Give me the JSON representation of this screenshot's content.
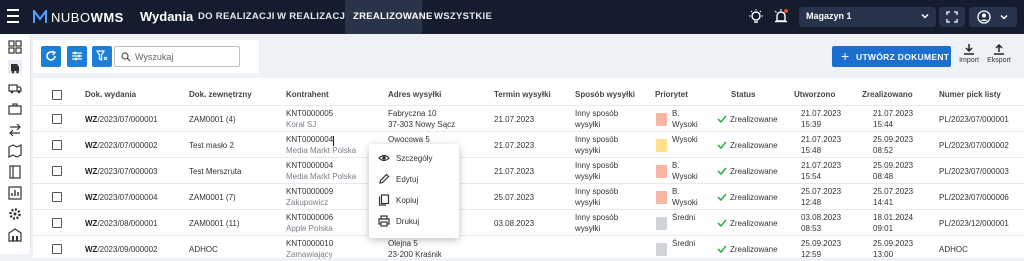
{
  "app": {
    "logo": "NUBOWMS",
    "logo_prefix": "NUBO",
    "logo_suffix": "WMS",
    "page_title": "Wydania"
  },
  "tabs": [
    {
      "label": "DO REALIZACJI"
    },
    {
      "label": "W REALIZACJI"
    },
    {
      "label": "ZREALIZOWANE"
    },
    {
      "label": "WSZYSTKIE"
    }
  ],
  "active_tab": "ZREALIZOWANE",
  "warehouse_select": {
    "value": "Magazyn 1"
  },
  "toolbar": {
    "search_placeholder": "Wyszukaj",
    "create_label": "UTWÓRZ DOKUMENT",
    "create_plus": "+",
    "import_label": "Import",
    "export_label": "Eksport"
  },
  "table": {
    "headers": [
      "Dok. wydania",
      "Dok. zewnętrzny",
      "Kontrahent",
      "Adres wysyłki",
      "Termin wysyłki",
      "Sposób wysyłki",
      "Priorytet",
      "Status",
      "Utworzono",
      "Zrealizowano",
      "Numer pick listy"
    ],
    "rows": [
      {
        "doc_prefix": "WZ",
        "doc_rest": "/2023/07/000001",
        "external": "ZAM0001 (4)",
        "contractor_code": "KNT0000005",
        "contractor_name": "Koral SJ",
        "address_1": "Fabryczna 10",
        "address_2": "37-303 Nowy Sącz",
        "ship_date": "21.07.2023",
        "ship_method_1": "Inny sposób",
        "ship_method_2": "wysyłki",
        "priority_1": "B.",
        "priority_2": "Wysoki",
        "status": "Zrealizowane",
        "created_date": "21.07.2023",
        "created_time": "15:39",
        "done_date": "21.07.2023",
        "done_time": "15:44",
        "pick_list": "PL/2023/07/000001"
      },
      {
        "doc_prefix": "WZ",
        "doc_rest": "/2023/07/000002",
        "external": "Test masło 2",
        "contractor_code": "KNT0000004",
        "contractor_name": "Media Markt Polska",
        "address_1": "Owocowa 5",
        "address_2": "",
        "ship_date": "21.07.2023",
        "ship_method_1": "Inny sposób",
        "ship_method_2": "wysyłki",
        "priority_1": "Wysoki",
        "priority_2": "",
        "status": "Zrealizowane",
        "created_date": "21.07.2023",
        "created_time": "15:48",
        "done_date": "25.09.2023",
        "done_time": "08:52",
        "pick_list": "PL/2023/07/000002"
      },
      {
        "doc_prefix": "WZ",
        "doc_rest": "/2023/07/000003",
        "external": "Test Merszruta",
        "contractor_code": "KNT0000004",
        "contractor_name": "Media Markt Polska",
        "address_1": "",
        "address_2": "",
        "ship_date": "21.07.2023",
        "ship_method_1": "Inny sposób",
        "ship_method_2": "wysyłki",
        "priority_1": "B.",
        "priority_2": "Wysoki",
        "status": "Zrealizowane",
        "created_date": "21.07.2023",
        "created_time": "15:54",
        "done_date": "25.09.2023",
        "done_time": "08:48",
        "pick_list": "PL/2023/07/000003"
      },
      {
        "doc_prefix": "WZ",
        "doc_rest": "/2023/07/000004",
        "external": "ZAM0001 (7)",
        "contractor_code": "KNT0000009",
        "contractor_name": "Zakupowicz",
        "address_1": "",
        "address_2": "",
        "ship_date": "25.07.2023",
        "ship_method_1": "Inny sposób",
        "ship_method_2": "wysyłki",
        "priority_1": "B.",
        "priority_2": "Wysoki",
        "status": "Zrealizowane",
        "created_date": "25.07.2023",
        "created_time": "12:48",
        "done_date": "25.07.2023",
        "done_time": "14:41",
        "pick_list": "PL/2023/07/000006"
      },
      {
        "doc_prefix": "WZ",
        "doc_rest": "/2023/08/000001",
        "external": "ZAM0001 (11)",
        "contractor_code": "KNT0000006",
        "contractor_name": "Apple Polska",
        "address_1": "",
        "address_2": "",
        "ship_date": "03.08.2023",
        "ship_method_1": "Inny sposób",
        "ship_method_2": "wysyłki",
        "priority_1": "Średni",
        "priority_2": "",
        "status": "Zrealizowane",
        "created_date": "03.08.2023",
        "created_time": "08:53",
        "done_date": "18.01.2024",
        "done_time": "09:01",
        "pick_list": "PL/2023/12/000001"
      },
      {
        "doc_prefix": "WZ",
        "doc_rest": "/2023/09/000002",
        "external": "ADHOC",
        "contractor_code": "KNT0000010",
        "contractor_name": "Zamawiający",
        "address_1": "Olejna 5",
        "address_2": "23-200 Kraśnik",
        "ship_date": "",
        "ship_method_1": "",
        "ship_method_2": "",
        "priority_1": "Średni",
        "priority_2": "",
        "status": "Zrealizowane",
        "created_date": "25.09.2023",
        "created_time": "12:59",
        "done_date": "25.09.2023",
        "done_time": "13:00",
        "pick_list": "ADHOC"
      }
    ]
  },
  "context_menu": [
    {
      "label": "Szczegóły",
      "icon": "eye-icon"
    },
    {
      "label": "Edytuj",
      "icon": "pencil-icon"
    },
    {
      "label": "Kopiuj",
      "icon": "copy-icon"
    },
    {
      "label": "Drukuj",
      "icon": "print-icon"
    }
  ],
  "colors": {
    "topbar": "#141c2e",
    "accent": "#1c7ed6",
    "status_ok": "#2fb344",
    "priority_high": "#f7b5a2",
    "priority_medium": "#ffe08a",
    "priority_low": "#d0d3d8"
  }
}
